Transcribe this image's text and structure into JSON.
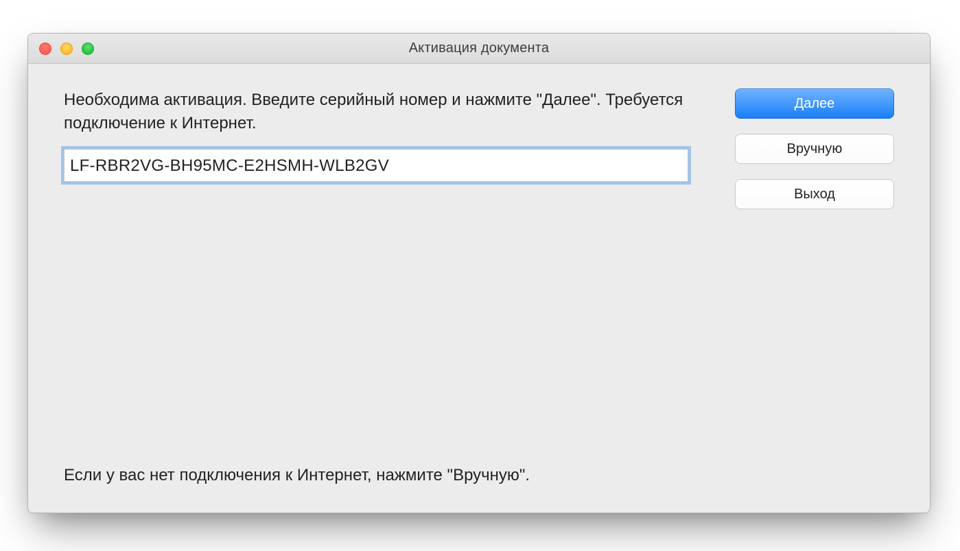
{
  "window": {
    "title": "Активация документа"
  },
  "main": {
    "instructions": "Необходима активация. Введите серийный номер и нажмите \"Далее\". Требуется подключение к Интернет.",
    "serial_value": "LF-RBR2VG-BH95MC-E2HSMH-WLB2GV",
    "footer_note": "Если у вас нет подключения к Интернет, нажмите \"Вручную\"."
  },
  "buttons": {
    "next": "Далее",
    "manual": "Вручную",
    "exit": "Выход"
  }
}
